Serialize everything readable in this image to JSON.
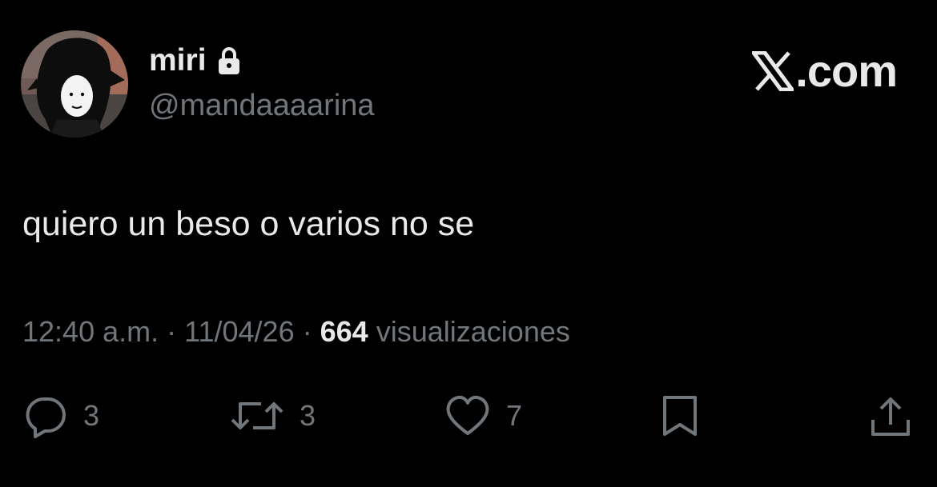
{
  "author": {
    "display_name": "miri",
    "handle": "@mandaaaarina",
    "protected_icon": "lock-icon",
    "avatar": "avatar-cartoon-girl"
  },
  "brand": {
    "logo_icon": "x-logo-icon",
    "text": ".com"
  },
  "tweet": {
    "text": "quiero un beso o varios no se"
  },
  "meta": {
    "time": "12:40 a.m.",
    "separator": "·",
    "date": "11/04/26",
    "views_count": "664",
    "views_label": "visualizaciones"
  },
  "actions": {
    "reply": {
      "icon": "reply-icon",
      "count": "3"
    },
    "retweet": {
      "icon": "retweet-icon",
      "count": "3"
    },
    "like": {
      "icon": "heart-icon",
      "count": "7"
    },
    "bookmark": {
      "icon": "bookmark-icon"
    },
    "share": {
      "icon": "share-icon"
    }
  },
  "colors": {
    "background": "#000000",
    "primary_text": "#e7e9ea",
    "secondary_text": "#71767b"
  }
}
